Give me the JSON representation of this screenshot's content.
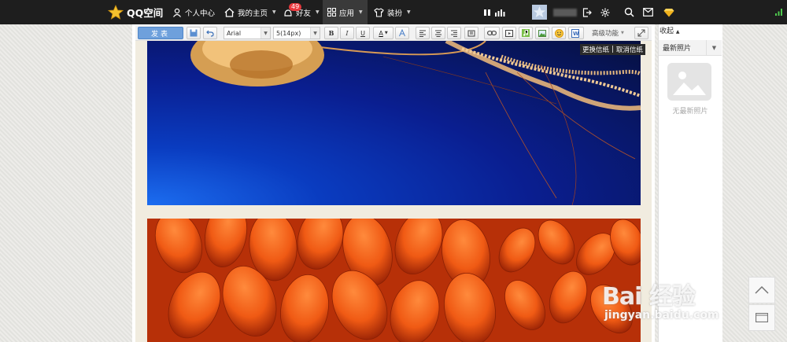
{
  "topbar": {
    "logo_text": "QQ空间",
    "personal_center": "个人中心",
    "my_homepage": "我的主页",
    "friends": "好友",
    "friends_badge": "49",
    "apps": "应用",
    "decorate": "装扮"
  },
  "editor": {
    "post_button": "发表",
    "font_family": "Arial",
    "font_size": "5(14px)",
    "bold": "B",
    "italic": "I",
    "underline": "U",
    "font_color": "A",
    "advanced": "高级功能",
    "change_paper": "更换信纸",
    "separator": "|",
    "cancel_paper": "取消信纸"
  },
  "right_panel": {
    "collapse": "收起",
    "latest_photos": "最新照片",
    "no_photos": "无最新照片"
  },
  "watermark": {
    "main": "Bai 经验",
    "sub": "jingyan.baidu.com"
  },
  "colors": {
    "topbar_bg": "#1e1e1e",
    "post_button_bg": "#6ea0dc",
    "badge_bg": "#e8383d"
  }
}
